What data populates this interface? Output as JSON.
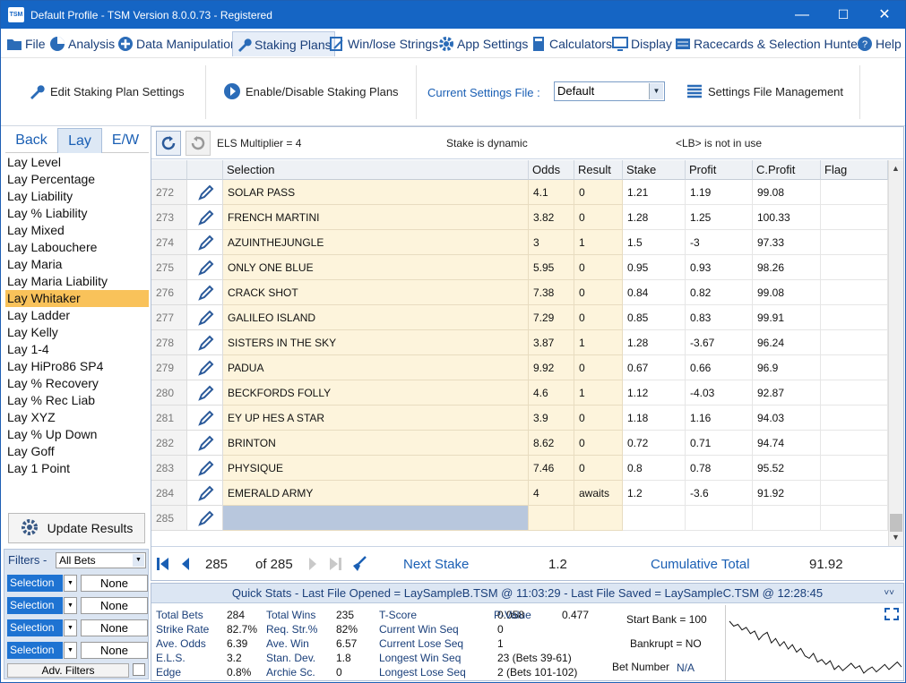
{
  "window": {
    "title": "Default Profile  -  TSM Version 8.0.0.73 - Registered",
    "logo": "TSM"
  },
  "menu": [
    "File",
    "Analysis",
    "Data Manipulation",
    "Staking Plans",
    "Win/lose Strings",
    "App Settings",
    "Calculators",
    "Display",
    "Racecards & Selection Hunter",
    "Help"
  ],
  "ribbon": {
    "edit": "Edit Staking Plan Settings",
    "toggle": "Enable/Disable Staking Plans",
    "settings_label": "Current Settings File :",
    "settings_value": "Default",
    "mgmt": "Settings File Management"
  },
  "tabs": [
    "Back",
    "Lay",
    "E/W"
  ],
  "plans": [
    "Lay Level",
    "Lay Percentage",
    "Lay Liability",
    "Lay % Liability",
    "Lay Mixed",
    "Lay Labouchere",
    "Lay Maria",
    "Lay Maria Liability",
    "Lay Whitaker",
    "Lay Ladder",
    "Lay Kelly",
    "Lay 1-4",
    "Lay HiPro86 SP4",
    "Lay % Recovery",
    "Lay % Rec Liab",
    "Lay XYZ",
    "Lay % Up Down",
    "Lay Goff",
    "Lay 1 Point"
  ],
  "selected_plan": "Lay Whitaker",
  "update_results": "Update Results",
  "filters": {
    "label": "Filters -",
    "bets": "All Bets",
    "rows": [
      {
        "sel": "Selection",
        "val": "None"
      },
      {
        "sel": "Selection",
        "val": "None"
      },
      {
        "sel": "Selection",
        "val": "None"
      },
      {
        "sel": "Selection",
        "val": "None"
      }
    ],
    "adv": "Adv. Filters"
  },
  "toolstrip": {
    "els": "ELS Multiplier = 4",
    "dynamic": "Stake is dynamic",
    "lb": "<LB> is not in use"
  },
  "columns": [
    "Selection",
    "Odds",
    "Result",
    "Stake",
    "Profit",
    "C.Profit",
    "Flag"
  ],
  "rows": [
    [
      "272",
      "SOLAR PASS",
      "4.1",
      "0",
      "1.21",
      "1.19",
      "99.08"
    ],
    [
      "273",
      "FRENCH MARTINI",
      "3.82",
      "0",
      "1.28",
      "1.25",
      "100.33"
    ],
    [
      "274",
      "AZUINTHEJUNGLE",
      "3",
      "1",
      "1.5",
      "-3",
      "97.33"
    ],
    [
      "275",
      "ONLY ONE BLUE",
      "5.95",
      "0",
      "0.95",
      "0.93",
      "98.26"
    ],
    [
      "276",
      "CRACK SHOT",
      "7.38",
      "0",
      "0.84",
      "0.82",
      "99.08"
    ],
    [
      "277",
      "GALILEO ISLAND",
      "7.29",
      "0",
      "0.85",
      "0.83",
      "99.91"
    ],
    [
      "278",
      "SISTERS IN THE SKY",
      "3.87",
      "1",
      "1.28",
      "-3.67",
      "96.24"
    ],
    [
      "279",
      "PADUA",
      "9.92",
      "0",
      "0.67",
      "0.66",
      "96.9"
    ],
    [
      "280",
      "BECKFORDS FOLLY",
      "4.6",
      "1",
      "1.12",
      "-4.03",
      "92.87"
    ],
    [
      "281",
      "EY UP HES A STAR",
      "3.9",
      "0",
      "1.18",
      "1.16",
      "94.03"
    ],
    [
      "282",
      "BRINTON",
      "8.62",
      "0",
      "0.72",
      "0.71",
      "94.74"
    ],
    [
      "283",
      "PHYSIQUE",
      "7.46",
      "0",
      "0.8",
      "0.78",
      "95.52"
    ],
    [
      "284",
      "EMERALD ARMY",
      "4",
      "awaits",
      "1.2",
      "-3.6",
      "91.92"
    ],
    [
      "285",
      "",
      "",
      "",
      "",
      "",
      ""
    ]
  ],
  "nav": {
    "current": "285",
    "of": "of 285",
    "next_label": "Next Stake",
    "next_val": "1.2",
    "cum_label": "Cumulative Total",
    "cum_val": "91.92"
  },
  "quickstats": {
    "header": "Quick Stats - Last File Opened = LaySampleB.TSM @ 11:03:29 - Last File Saved = LaySampleC.TSM @ 12:28:45",
    "c1": [
      [
        "Total Bets",
        "284"
      ],
      [
        "Strike Rate",
        "82.7%"
      ],
      [
        "Ave. Odds",
        "6.39"
      ],
      [
        "E.L.S.",
        "3.2"
      ],
      [
        "Edge",
        "0.8%"
      ]
    ],
    "c2": [
      [
        "Total Wins",
        "235"
      ],
      [
        "Req. Str.%",
        "82%"
      ],
      [
        "Ave. Win",
        "6.57"
      ],
      [
        "Stan. Dev.",
        "1.8"
      ],
      [
        "Archie Sc.",
        "0"
      ]
    ],
    "c3": [
      [
        "T-Score",
        "0.058"
      ],
      [
        "Current Win Seq",
        "0"
      ],
      [
        "Current Lose Seq",
        "1"
      ],
      [
        "Longest Win Seq",
        "23  (Bets 39-61)"
      ],
      [
        "Longest Lose Seq",
        "2  (Bets 101-102)"
      ]
    ],
    "pvalue": [
      "P-Value",
      "0.477"
    ],
    "start_bank": "Start Bank = 100",
    "bankrupt": "Bankrupt = NO",
    "bet_number_label": "Bet Number",
    "bet_number_val": "N/A"
  },
  "spark": [
    0,
    8,
    5,
    14,
    10,
    20,
    16,
    30,
    22,
    18,
    35,
    28,
    40,
    33,
    45,
    38,
    50,
    44,
    56,
    60,
    52,
    66,
    62,
    70,
    64,
    78,
    72,
    80,
    74,
    68,
    76,
    72,
    84,
    78,
    74,
    82,
    76,
    70,
    78,
    72,
    66,
    74
  ]
}
